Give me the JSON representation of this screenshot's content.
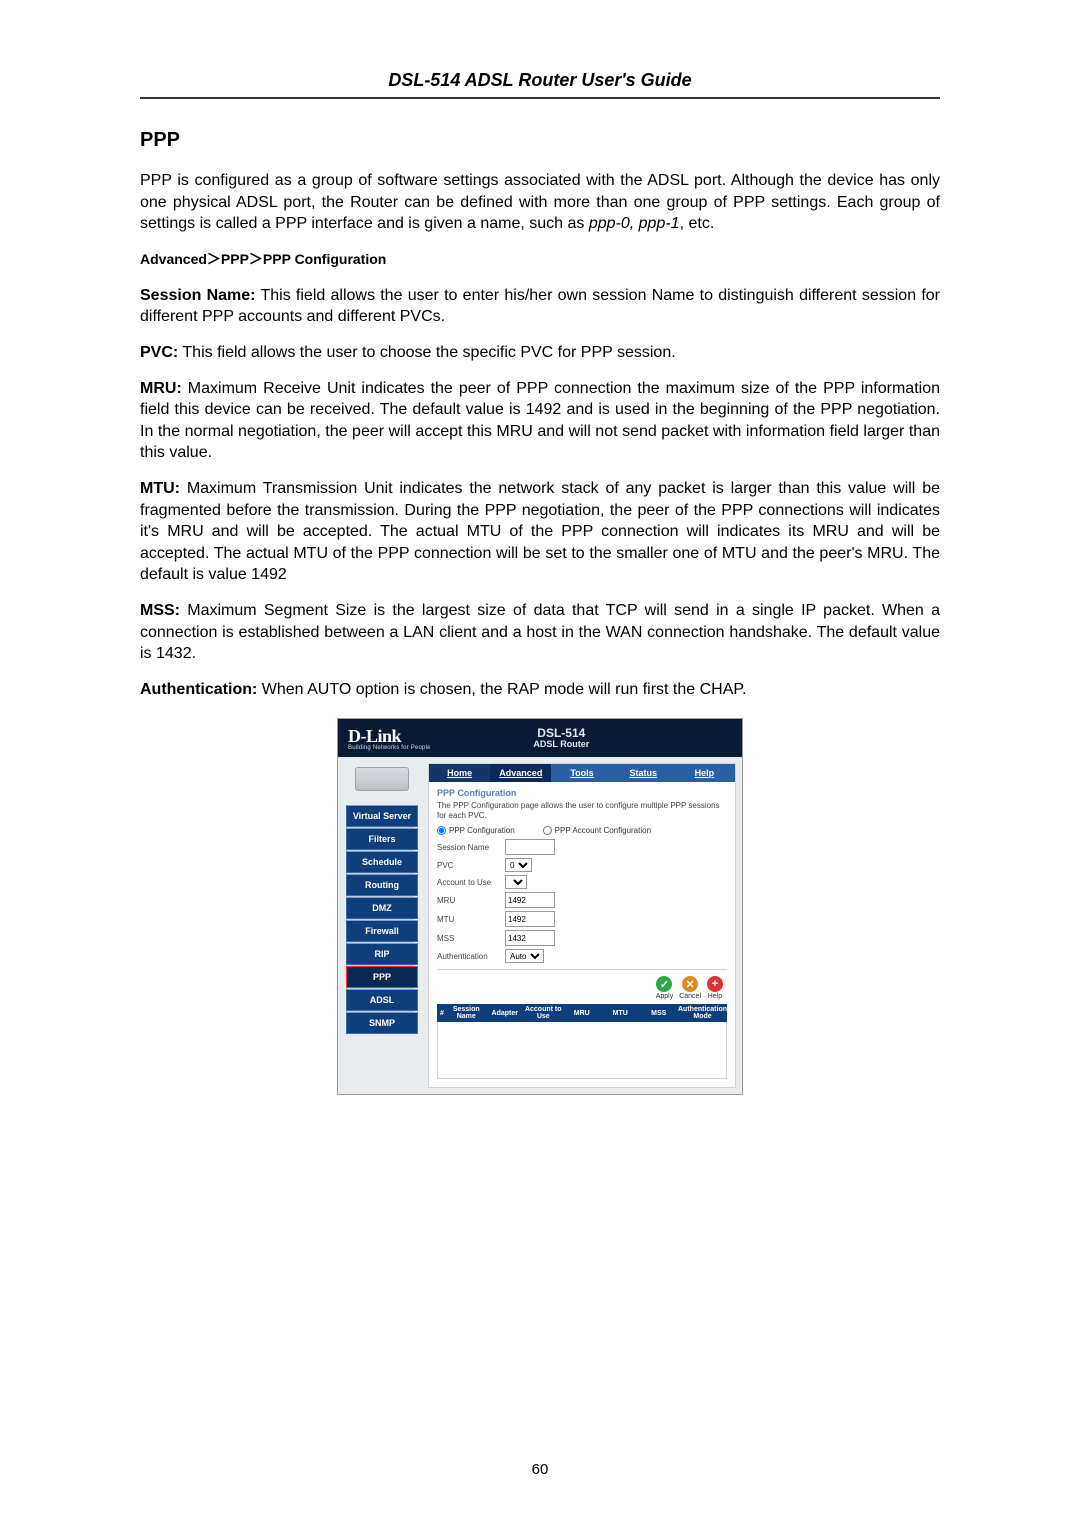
{
  "header": {
    "title": "DSL-514 ADSL Router User's Guide"
  },
  "section_heading": "PPP",
  "intro_para": "PPP is configured as a group of software settings associated with the ADSL port. Although the device has only one physical ADSL port, the Router can be defined with more than one group of PPP settings. Each group of settings is called a PPP interface and is given a name, such as ",
  "intro_italic": "ppp-0, ppp-1",
  "intro_tail": ", etc.",
  "breadcrumb": "Advanced＞PPP＞PPP Configuration",
  "paras": {
    "session_name_label": "Session Name:",
    "session_name_text": " This field allows the user to enter his/her own session Name to distinguish different session for different PPP accounts and different PVCs.",
    "pvc_label": "PVC:",
    "pvc_text": " This field allows the user to choose the specific PVC for PPP session.",
    "mru_label": "MRU:",
    "mru_text": " Maximum Receive Unit indicates the peer of PPP connection the maximum size of the PPP information field this device can be received. The default value is 1492 and is used in the beginning of the PPP negotiation. In the normal negotiation, the peer will accept this MRU and will not send packet with information field larger than this value.",
    "mtu_label": "MTU:",
    "mtu_text": " Maximum Transmission Unit indicates the network stack of any packet is larger than this value will be fragmented before the transmission. During the PPP negotiation, the peer of the PPP connections will indicates it's MRU and will be accepted. The actual MTU of the PPP connection will indicates its MRU and will be accepted. The actual MTU of the PPP connection will be set to the smaller one of MTU and the peer's MRU. The default is value 1492",
    "mss_label": "MSS:",
    "mss_text": " Maximum Segment Size is the largest size of data that TCP will send in a single IP packet. When a connection is established between a LAN client and a host in the WAN connection handshake. The default value is 1432.",
    "auth_label": "Authentication:",
    "auth_text": " When AUTO option is chosen, the RAP mode will run first the CHAP."
  },
  "screenshot": {
    "brand": "D-Link",
    "brand_sub": "Building Networks for People",
    "model": "DSL-514",
    "model_sub": "ADSL Router",
    "tabs": {
      "home": "Home",
      "advanced": "Advanced",
      "tools": "Tools",
      "status": "Status",
      "help": "Help"
    },
    "sidebar": [
      "Virtual Server",
      "Filters",
      "Schedule",
      "Routing",
      "DMZ",
      "Firewall",
      "RIP",
      "PPP",
      "ADSL",
      "SNMP"
    ],
    "sidebar_active_index": 7,
    "panel_title": "PPP Configuration",
    "panel_desc": "The PPP Configuration page allows the user to configure multiple PPP sessions for each PVC.",
    "radio_cfg": "PPP Configuration",
    "radio_acct": "PPP Account Configuration",
    "fields": {
      "session_name": {
        "label": "Session Name",
        "value": ""
      },
      "pvc": {
        "label": "PVC",
        "value": "0"
      },
      "account": {
        "label": "Account to Use",
        "value": ""
      },
      "mru": {
        "label": "MRU",
        "value": "1492"
      },
      "mtu": {
        "label": "MTU",
        "value": "1492"
      },
      "mss": {
        "label": "MSS",
        "value": "1432"
      },
      "auth": {
        "label": "Authentication",
        "value": "Auto"
      }
    },
    "actions": {
      "apply": "Apply",
      "cancel": "Cancel",
      "help": "Help"
    },
    "table_headers": [
      "#",
      "Session Name",
      "Adapter",
      "Account to Use",
      "MRU",
      "MTU",
      "MSS",
      "Authentication Mode"
    ]
  },
  "page_number": "60"
}
